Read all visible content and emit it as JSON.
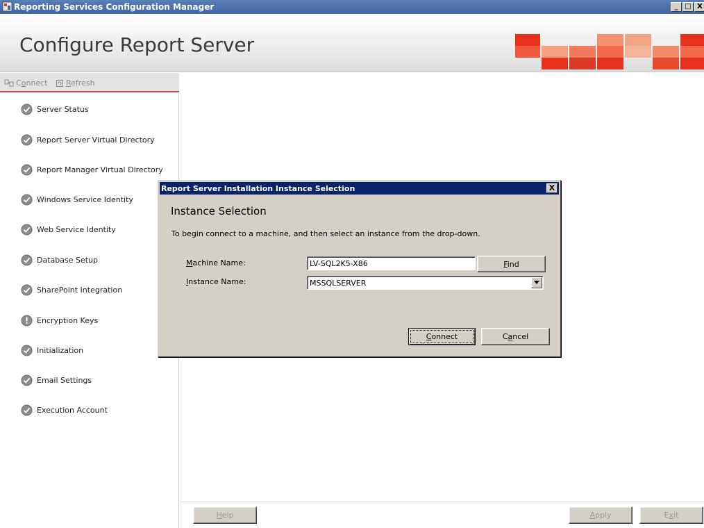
{
  "window": {
    "title": "Reporting Services Configuration Manager",
    "minimize": "_",
    "maximize": "□",
    "close": "X"
  },
  "header": {
    "title": "Configure Report Server"
  },
  "toolbar": {
    "connect": {
      "prefix": "C",
      "underline": "o",
      "suffix": "nnect"
    },
    "refresh": {
      "prefix": "",
      "underline": "R",
      "suffix": "efresh"
    }
  },
  "sidebar": {
    "items": [
      {
        "label": "Server Status",
        "status": "ok"
      },
      {
        "label": "Report Server Virtual Directory",
        "status": "ok"
      },
      {
        "label": "Report Manager Virtual Directory",
        "status": "ok"
      },
      {
        "label": "Windows Service Identity",
        "status": "ok"
      },
      {
        "label": "Web Service Identity",
        "status": "ok"
      },
      {
        "label": "Database Setup",
        "status": "ok"
      },
      {
        "label": "SharePoint Integration",
        "status": "ok"
      },
      {
        "label": "Encryption Keys",
        "status": "info"
      },
      {
        "label": "Initialization",
        "status": "ok"
      },
      {
        "label": "Email Settings",
        "status": "ok"
      },
      {
        "label": "Execution Account",
        "status": "ok"
      }
    ]
  },
  "footer": {
    "help": {
      "prefix": "",
      "underline": "H",
      "suffix": "elp"
    },
    "apply": {
      "prefix": "",
      "underline": "A",
      "suffix": "pply"
    },
    "exit": {
      "prefix": "E",
      "underline": "x",
      "suffix": "it"
    }
  },
  "dialog": {
    "title": "Report Server Installation Instance Selection",
    "close": "X",
    "heading": "Instance Selection",
    "instructions": "To begin connect to a machine, and then select an instance from the drop-down.",
    "machine_label": {
      "prefix": "",
      "underline": "M",
      "suffix": "achine Name:"
    },
    "machine_value": "LV-SQL2K5-X86",
    "find": {
      "prefix": "",
      "underline": "F",
      "suffix": "ind"
    },
    "instance_label": {
      "prefix": "",
      "underline": "I",
      "suffix": "nstance Name:"
    },
    "instance_value": "MSSQLSERVER",
    "connect": {
      "prefix": "",
      "underline": "C",
      "suffix": "onnect"
    },
    "cancel": {
      "prefix": "C",
      "underline": "a",
      "suffix": "ncel"
    }
  },
  "colors": {
    "accent_red": "#c24b3c",
    "titlebar_blue": "#3f65a3",
    "dialog_title_blue": "#0a246a",
    "status_ok": "#7a7a7a"
  },
  "icons": {
    "status_ok": "check-circle-icon",
    "status_info": "info-circle-icon",
    "toolbar_connect": "connect-icon",
    "toolbar_refresh": "refresh-icon"
  }
}
